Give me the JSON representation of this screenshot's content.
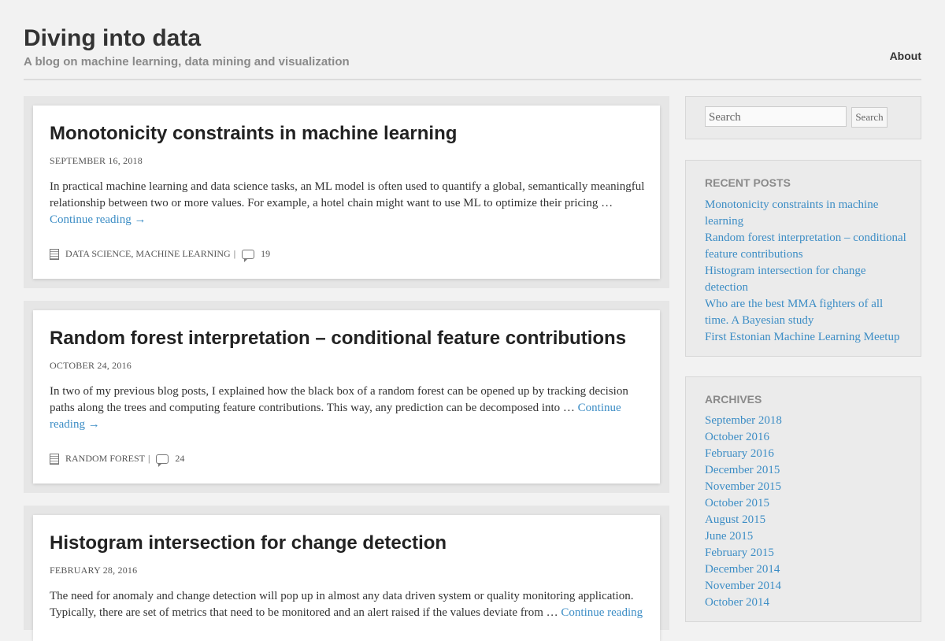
{
  "site": {
    "title": "Diving into data",
    "description": "A blog on machine learning, data mining and visualization",
    "nav_about": "About"
  },
  "posts": [
    {
      "title": "Monotonicity constraints in machine learning",
      "date": "SEPTEMBER 16, 2018",
      "excerpt": "In practical machine learning and data science tasks, an ML model is often used to quantify a global, semantically meaningful relationship between two or more values. For example, a hotel chain might want to use ML to optimize their pricing …",
      "continue": "Continue reading →",
      "categories": "DATA SCIENCE, MACHINE LEARNING",
      "separator": "|",
      "comments": "19"
    },
    {
      "title": "Random forest interpretation – conditional feature contributions",
      "date": "OCTOBER 24, 2016",
      "excerpt": "In two of my previous blog posts, I explained how the black box of a random forest can be opened up by tracking decision paths along the trees and computing feature contributions. This way, any prediction can be decomposed into …",
      "continue": "Continue reading →",
      "categories": "RANDOM FOREST",
      "separator": "|",
      "comments": "24"
    },
    {
      "title": "Histogram intersection for change detection",
      "date": "FEBRUARY 28, 2016",
      "excerpt": "The need for anomaly and change detection will pop up in almost any data driven system or quality monitoring application. Typically, there are set of metrics that need to be monitored and an alert raised if the values deviate from …",
      "continue": "Continue reading"
    }
  ],
  "sidebar": {
    "search_placeholder": "Search",
    "search_button": "Search",
    "recent_title": "RECENT POSTS",
    "recent": [
      "Monotonicity constraints in machine learning",
      "Random forest interpretation – conditional feature contributions",
      "Histogram intersection for change detection",
      "Who are the best MMA fighters of all time. A Bayesian study",
      "First Estonian Machine Learning Meetup"
    ],
    "archives_title": "ARCHIVES",
    "archives": [
      "September 2018",
      "October 2016",
      "February 2016",
      "December 2015",
      "November 2015",
      "October 2015",
      "August 2015",
      "June 2015",
      "February 2015",
      "December 2014",
      "November 2014",
      "October 2014"
    ]
  }
}
